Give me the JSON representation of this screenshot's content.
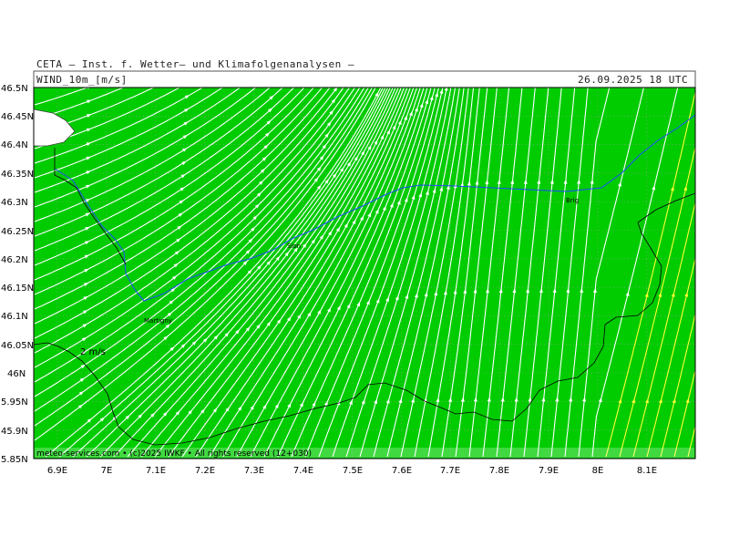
{
  "header": {
    "institution": "CETA — Inst. f. Wetter— und Klimafolgenanalysen —",
    "field": "WIND_10m_[m/s]",
    "valid_time": "26.09.2025 18 UTC"
  },
  "map": {
    "lat_ticks": [
      "46.5N",
      "46.45N",
      "46.4N",
      "46.35N",
      "46.3N",
      "46.25N",
      "46.2N",
      "46.15N",
      "46.1N",
      "46.05N",
      "46N",
      "5.95N",
      "45.9N",
      "5.85N"
    ],
    "lon_ticks": [
      "6.9E",
      "7E",
      "7.1E",
      "7.2E",
      "7.3E",
      "7.4E",
      "7.5E",
      "7.6E",
      "7.7E",
      "7.8E",
      "7.9E",
      "8E",
      "8.1E"
    ],
    "places": [
      {
        "name": "Brig"
      },
      {
        "name": "Sion"
      },
      {
        "name": "Martigny"
      }
    ],
    "contour_label": "2 m/s",
    "footer": "meteo-services.com • (c)2025 IWKF • All rights reserved (12+030)",
    "colors": {
      "field": "#00cc00",
      "streamline": "#ffffff",
      "strong_streamline": "#ffff33",
      "river": "#1f4fff",
      "border": "#000000",
      "grid": "#9aa09a"
    }
  }
}
